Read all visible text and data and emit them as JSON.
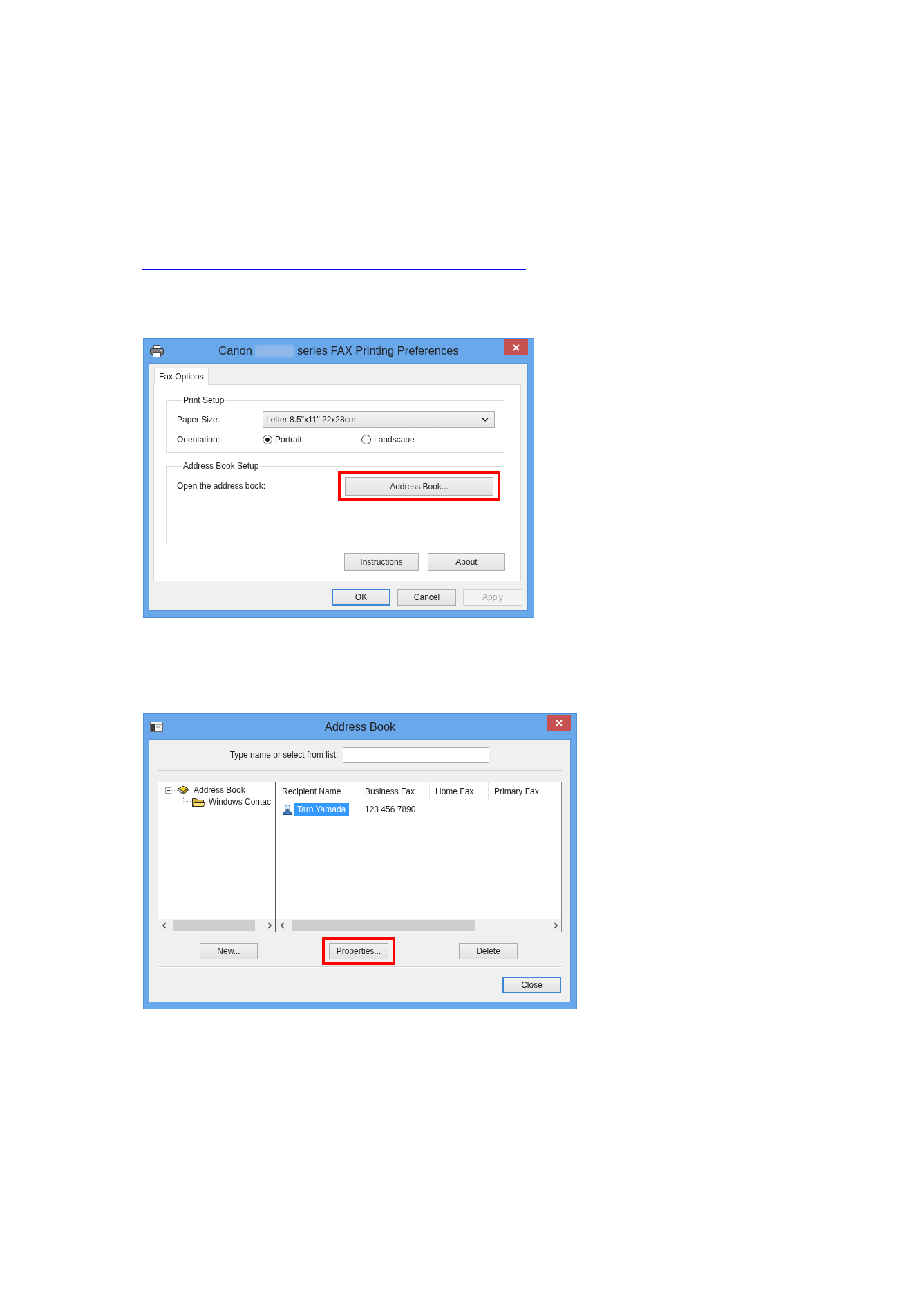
{
  "preferences_dialog": {
    "title_prefix": "Canon",
    "title_suffix": "series FAX Printing Preferences",
    "tabs": [
      {
        "label": "Fax Options",
        "selected": true
      }
    ],
    "print_setup": {
      "title": "Print Setup",
      "paper_size_label": "Paper Size:",
      "paper_size_value": "Letter 8.5\"x11\" 22x28cm",
      "orientation_label": "Orientation:",
      "orientation_options": [
        {
          "label": "Portrait",
          "selected": true
        },
        {
          "label": "Landscape",
          "selected": false
        }
      ]
    },
    "address_book_setup": {
      "title": "Address Book Setup",
      "label": "Open the address book:",
      "button": {
        "label": "Address Book...",
        "highlighted": true
      }
    },
    "panel_buttons": [
      {
        "label": "Instructions",
        "highlighted": false
      },
      {
        "label": "About",
        "highlighted": false
      }
    ],
    "buttons": [
      {
        "label": "OK",
        "default": true,
        "disabled": false
      },
      {
        "label": "Cancel",
        "default": false,
        "disabled": false
      },
      {
        "label": "Apply",
        "default": false,
        "disabled": true
      }
    ]
  },
  "address_book_dialog": {
    "title": "Address Book",
    "search_label": "Type name or select from list:",
    "tree": [
      {
        "label": "Address Book",
        "kind": "book",
        "expanded": true,
        "children": [
          {
            "label": "Windows Contac",
            "kind": "folder"
          }
        ]
      }
    ],
    "columns": [
      "Recipient Name",
      "Business Fax",
      "Home Fax",
      "Primary Fax"
    ],
    "rows": [
      {
        "cells": [
          "Taro Yamada",
          "123 456 7890"
        ],
        "selected": true
      }
    ],
    "buttons": [
      {
        "label": "New...",
        "highlighted": false
      },
      {
        "label": "Properties...",
        "highlighted": true
      },
      {
        "label": "Delete",
        "highlighted": false
      }
    ],
    "footer_buttons": [
      {
        "label": "Close",
        "default": true
      }
    ]
  }
}
